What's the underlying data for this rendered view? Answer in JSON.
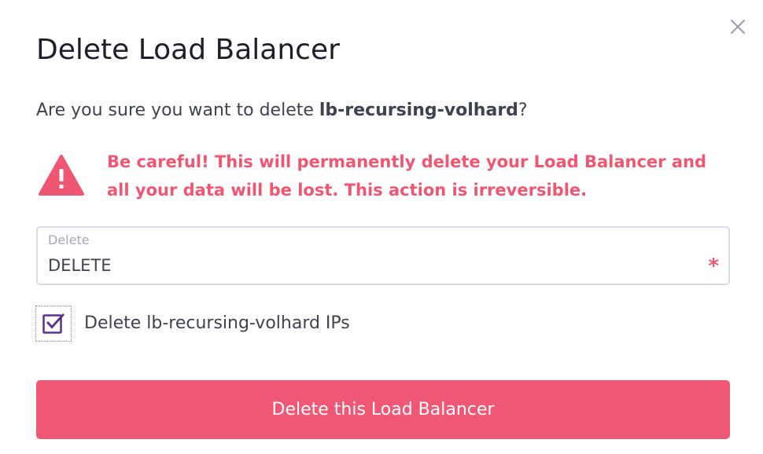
{
  "dialog": {
    "title": "Delete Load Balancer",
    "close_icon": "close-icon"
  },
  "confirmation": {
    "prefix": "Are you sure you want to delete ",
    "resource_name": "lb-recursing-volhard",
    "suffix": "?"
  },
  "warning": {
    "icon": "warning-triangle-icon",
    "text": "Be careful! This will permanently delete your Load Balancer and all your data will be lost. This action is irreversible.",
    "color": "#ef5672"
  },
  "confirm_field": {
    "label": "Delete",
    "value": "DELETE",
    "required_mark": "*"
  },
  "ips_checkbox": {
    "checked": true,
    "label": "Delete lb-recursing-volhard IPs",
    "color": "#5b2e91"
  },
  "submit": {
    "label": "Delete this Load Balancer",
    "color": "#ef5775"
  }
}
